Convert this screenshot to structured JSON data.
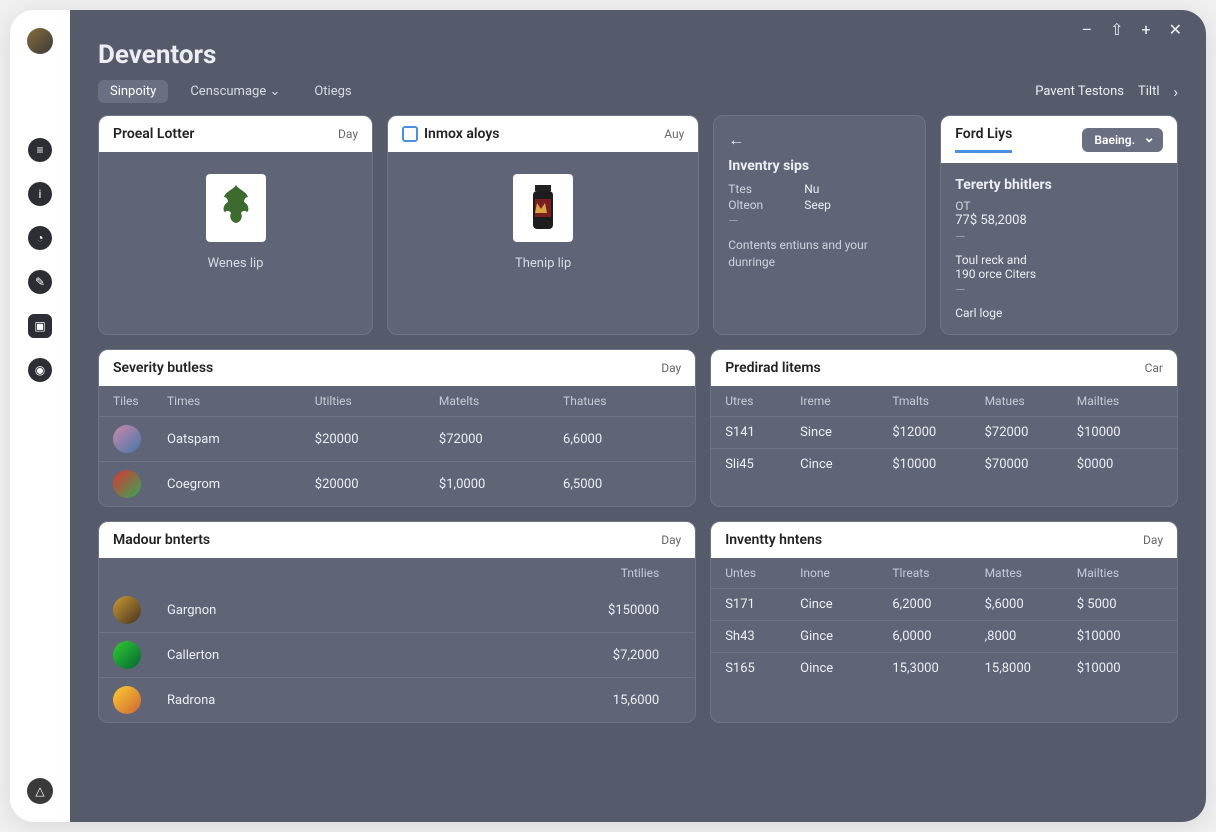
{
  "titlebar": {
    "minimize": "–",
    "export": "⇧",
    "plus": "+",
    "close": "✕"
  },
  "app_title": "Deventors",
  "tabs": {
    "items": [
      {
        "label": "Sinpoity",
        "active": true
      },
      {
        "label": "Censcumage ⌄",
        "active": false
      },
      {
        "label": "Otiegs",
        "active": false
      }
    ],
    "right": {
      "label1": "Pavent Testons",
      "label2": "Tiltl"
    }
  },
  "card_proreal": {
    "title": "Proeal Lotter",
    "badge": "Day",
    "caption": "Wenes lip"
  },
  "card_inmox": {
    "title": "Inmox aloys",
    "badge": "Auy",
    "caption": "Thenip lip"
  },
  "card_inventry": {
    "heading": "Inventry sips",
    "kv": [
      {
        "k": "Ttes",
        "v": "Nu"
      },
      {
        "k": "Olteon",
        "v": "Seep"
      }
    ],
    "desc": "Contents entiuns and your dunringe"
  },
  "card_fordliys": {
    "tab": "Ford Liys",
    "select": "Baeing.",
    "heading": "Tererty bhitlers",
    "line1": "OT",
    "line2": "77$ 58,2008",
    "line3": "Toul reck and",
    "line4": "190 orce Citers",
    "line5": "Carl loge"
  },
  "table_severity": {
    "title": "Severity butless",
    "badge": "Day",
    "cols": [
      "Tiles",
      "Times",
      "Utilties",
      "Matelts",
      "Thatues"
    ],
    "rows": [
      {
        "name": "Oatspam",
        "c1": "$20000",
        "c2": "$72000",
        "c3": "6,6000"
      },
      {
        "name": "Coegrom",
        "c1": "$20000",
        "c2": "$1,0000",
        "c3": "6,5000"
      }
    ]
  },
  "table_predirad": {
    "title": "Predirad litems",
    "badge": "Car",
    "cols": [
      "Utres",
      "Ireme",
      "Tmalts",
      "Matues",
      "Mailties"
    ],
    "rows": [
      {
        "c0": "S141",
        "c1": "Since",
        "c2": "$12000",
        "c3": "$72000",
        "c4": "$10000"
      },
      {
        "c0": "Sli45",
        "c1": "Cince",
        "c2": "$10000",
        "c3": "$70000",
        "c4": "$0000"
      }
    ]
  },
  "table_madour": {
    "title": "Madour bnterts",
    "badge": "Day",
    "col_right": "Tntilies",
    "rows": [
      {
        "name": "Gargnon",
        "v": "$150000"
      },
      {
        "name": "Callerton",
        "v": "$7,2000"
      },
      {
        "name": "Radrona",
        "v": "15,6000"
      }
    ]
  },
  "table_inventty": {
    "title": "Inventty hntens",
    "badge": "Day",
    "cols": [
      "Untes",
      "Inone",
      "Tlreats",
      "Mattes",
      "Mailties"
    ],
    "rows": [
      {
        "c0": "S171",
        "c1": "Cince",
        "c2": "6,2000",
        "c3": "$,6000",
        "c4": "$ 5000"
      },
      {
        "c0": "Sh43",
        "c1": "Gince",
        "c2": "6,0000",
        "c3": ",8000",
        "c4": "$10000"
      },
      {
        "c0": "S165",
        "c1": "Oince",
        "c2": "15,3000",
        "c3": "15,8000",
        "c4": "$10000"
      }
    ]
  }
}
